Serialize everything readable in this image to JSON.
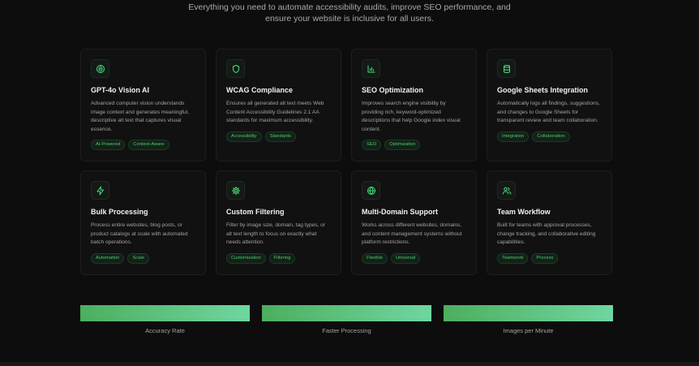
{
  "header": {
    "subtitle_line1": "Everything you need to automate accessibility audits, improve SEO performance, and",
    "subtitle_line2": "ensure your website is inclusive for all users."
  },
  "features": [
    {
      "icon": "brain-icon",
      "title": "GPT-4o Vision AI",
      "description": "Advanced computer vision understands image context and generates meaningful, descriptive alt text that captures visual essence.",
      "tags": [
        "AI-Powered",
        "Context-Aware"
      ]
    },
    {
      "icon": "shield-icon",
      "title": "WCAG Compliance",
      "description": "Ensures all generated alt text meets Web Content Accessibility Guidelines 2.1 AA standards for maximum accessibility.",
      "tags": [
        "Accessibility",
        "Standards"
      ]
    },
    {
      "icon": "bar-chart-icon",
      "title": "SEO Optimization",
      "description": "Improves search engine visibility by providing rich, keyword-optimized descriptions that help Google index visual content.",
      "tags": [
        "SEO",
        "Optimization"
      ]
    },
    {
      "icon": "database-icon",
      "title": "Google Sheets Integration",
      "description": "Automatically logs all findings, suggestions, and changes to Google Sheets for transparent review and team collaboration.",
      "tags": [
        "Integration",
        "Collaboration"
      ]
    },
    {
      "icon": "lightning-icon",
      "title": "Bulk Processing",
      "description": "Process entire websites, blog posts, or product catalogs at scale with automated batch operations.",
      "tags": [
        "Automation",
        "Scale"
      ]
    },
    {
      "icon": "gear-icon",
      "title": "Custom Filtering",
      "description": "Filter by image size, domain, tag types, or alt text length to focus on exactly what needs attention.",
      "tags": [
        "Customization",
        "Filtering"
      ]
    },
    {
      "icon": "globe-icon",
      "title": "Multi-Domain Support",
      "description": "Works across different websites, domains, and content management systems without platform restrictions.",
      "tags": [
        "Flexible",
        "Universal"
      ]
    },
    {
      "icon": "users-icon",
      "title": "Team Workflow",
      "description": "Built for teams with approval processes, change tracking, and collaborative editing capabilities.",
      "tags": [
        "Teamwork",
        "Process"
      ]
    }
  ],
  "stats": [
    {
      "label": "Accuracy Rate"
    },
    {
      "label": "Faster Processing"
    },
    {
      "label": "Images per Minute"
    }
  ],
  "colors": {
    "accent": "#4ade80",
    "tag_text": "#55c472",
    "background": "#0d0d0d",
    "card": "#111111"
  }
}
